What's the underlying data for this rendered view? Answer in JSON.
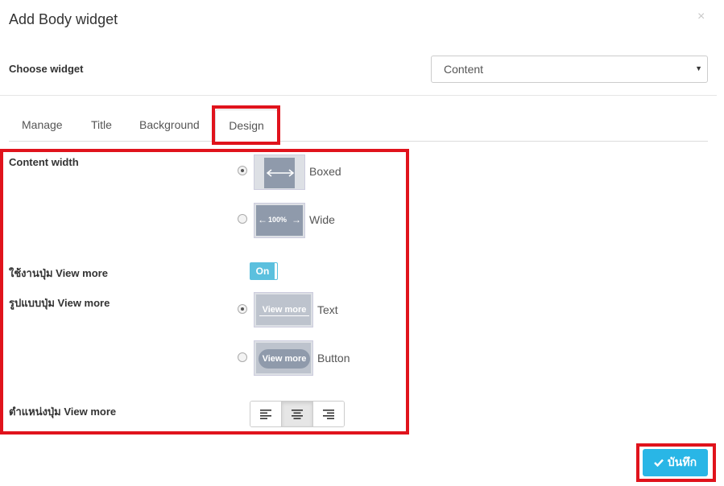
{
  "modal": {
    "title": "Add Body widget",
    "close_glyph": "×"
  },
  "choose_widget": {
    "label": "Choose widget",
    "selected": "Content",
    "caret": "▼"
  },
  "tabs": [
    {
      "label": "Manage"
    },
    {
      "label": "Title"
    },
    {
      "label": "Background"
    },
    {
      "label": "Design",
      "active": true
    }
  ],
  "design": {
    "content_width": {
      "label": "Content width",
      "options": [
        {
          "label": "Boxed",
          "checked": true
        },
        {
          "label": "Wide",
          "checked": false,
          "thumb_text": "100%"
        }
      ]
    },
    "view_more_enable": {
      "label": "ใช้งานปุ่ม View more",
      "toggle_label": "On",
      "state": "on"
    },
    "view_more_style": {
      "label": "รูปแบบปุ่ม View more",
      "options": [
        {
          "label": "Text",
          "checked": true,
          "thumb_text": "View more"
        },
        {
          "label": "Button",
          "checked": false,
          "thumb_text": "View more"
        }
      ]
    },
    "view_more_position": {
      "label": "ตำแหน่งปุ่ม View more",
      "alignments": [
        {
          "icon": "align-left-icon"
        },
        {
          "icon": "align-center-icon",
          "active": true
        },
        {
          "icon": "align-right-icon"
        }
      ]
    }
  },
  "footer": {
    "save_label": "บันทึก",
    "save_icon": "check-icon"
  },
  "colors": {
    "highlight": "#e0131c",
    "primary": "#29b6e6",
    "toggle": "#5bc0de",
    "thumb_fill": "#8f9aab"
  }
}
